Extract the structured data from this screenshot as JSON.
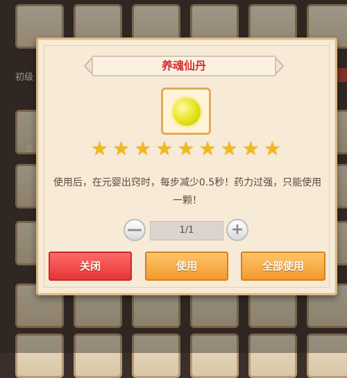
{
  "dialog": {
    "title": "养魂仙丹",
    "item_icon": "golden-pill-icon",
    "stars": 9,
    "star_symbol": "★",
    "description": "使用后，在元婴出窍时，每步减少0.5秒！药力过强，只能使用一颗！",
    "quantity": {
      "value": "1/1",
      "minus": "—",
      "plus": "+"
    },
    "buttons": {
      "close": "关闭",
      "use": "使用",
      "use_all": "全部使用"
    }
  },
  "background": {
    "side_label": "初级",
    "side_count": "8"
  },
  "colors": {
    "title_red": "#d52f2f",
    "close_red": "#e63535",
    "use_orange": "#f29a2e",
    "star_gold": "#f5b818",
    "panel_bg": "#f7ead6"
  }
}
